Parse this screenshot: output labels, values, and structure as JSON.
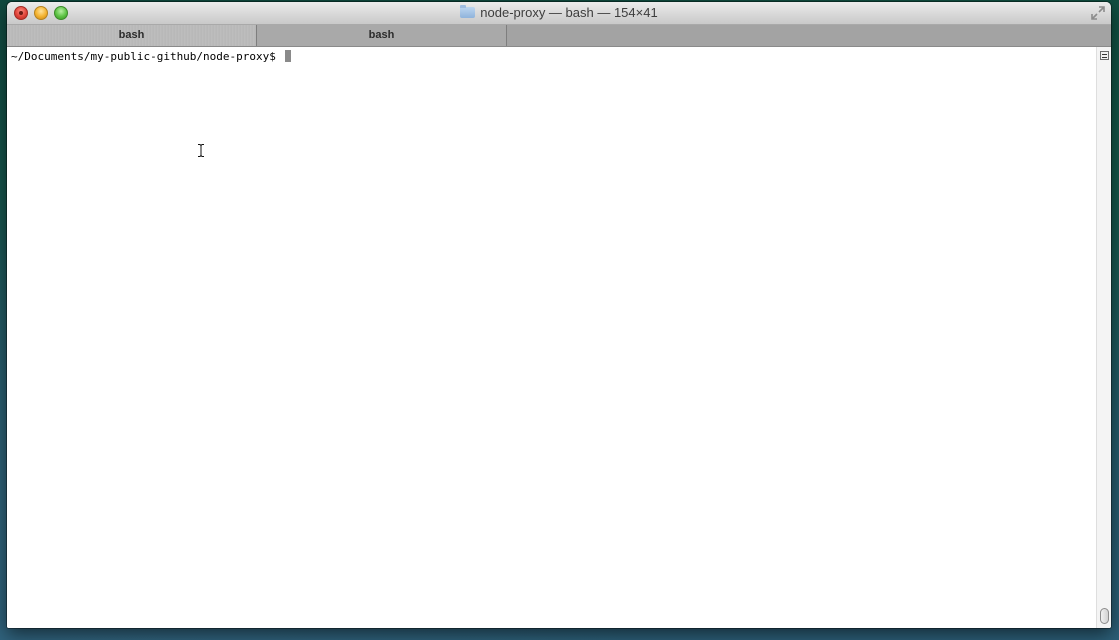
{
  "window": {
    "title": "node-proxy — bash — 154×41",
    "folder_icon": "folder-icon",
    "buttons": [
      "close-icon",
      "minimize-icon",
      "zoom-icon",
      "fullscreen-icon"
    ]
  },
  "tabs": [
    {
      "label": "bash",
      "active": true
    },
    {
      "label": "bash",
      "active": false
    }
  ],
  "terminal": {
    "prompt": "~/Documents/my-public-github/node-proxy$ ",
    "cursor": "block-cursor",
    "pointer": "text-ibeam-cursor"
  },
  "colors": {
    "close": "#e0443a",
    "minimize": "#f3b22e",
    "zoom": "#5cc243",
    "tab_bar": "#a3a3a3",
    "terminal_bg": "#ffffff"
  }
}
